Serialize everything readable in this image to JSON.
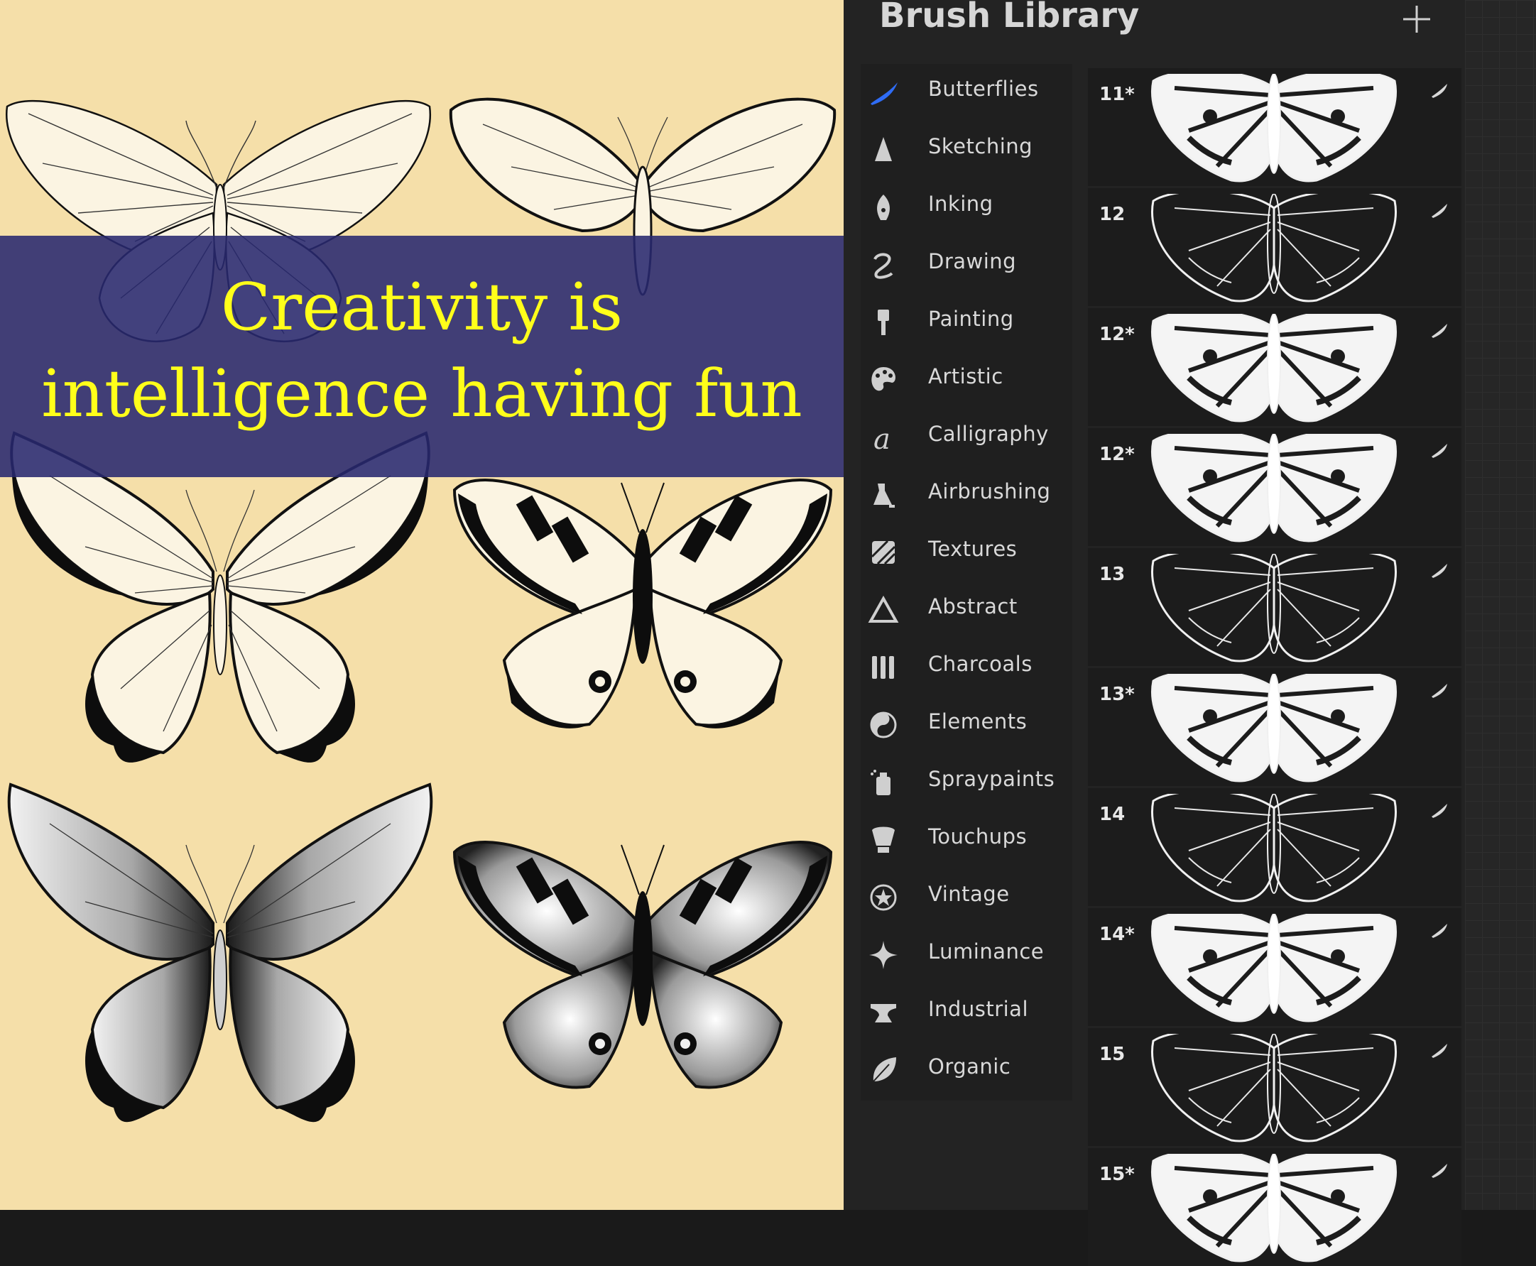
{
  "canvas": {
    "quote_line1": "Creativity is",
    "quote_line2": "intelligence having fun",
    "background_color": "#f5dfa9",
    "banner_color": "#2a2a6e",
    "quote_color": "#ffff1a"
  },
  "panel": {
    "title": "Brush Library",
    "add_icon": "plus-icon"
  },
  "brush_sets": [
    {
      "label": "Butterflies",
      "icon": "brush-stroke-icon",
      "selected": true
    },
    {
      "label": "Sketching",
      "icon": "pencil-tip-icon"
    },
    {
      "label": "Inking",
      "icon": "pen-nib-icon"
    },
    {
      "label": "Drawing",
      "icon": "squiggle-icon"
    },
    {
      "label": "Painting",
      "icon": "paint-brush-icon"
    },
    {
      "label": "Artistic",
      "icon": "palette-icon"
    },
    {
      "label": "Calligraphy",
      "icon": "script-a-icon"
    },
    {
      "label": "Airbrushing",
      "icon": "airbrush-icon"
    },
    {
      "label": "Textures",
      "icon": "hatch-square-icon"
    },
    {
      "label": "Abstract",
      "icon": "triangle-icon"
    },
    {
      "label": "Charcoals",
      "icon": "charcoal-sticks-icon"
    },
    {
      "label": "Elements",
      "icon": "yin-yang-icon"
    },
    {
      "label": "Spraypaints",
      "icon": "spray-can-icon"
    },
    {
      "label": "Touchups",
      "icon": "bucket-icon"
    },
    {
      "label": "Vintage",
      "icon": "star-circle-icon"
    },
    {
      "label": "Luminance",
      "icon": "sparkle-icon"
    },
    {
      "label": "Industrial",
      "icon": "anvil-icon"
    },
    {
      "label": "Organic",
      "icon": "leaf-icon"
    }
  ],
  "brushes": [
    {
      "number": "11*",
      "style": "filled"
    },
    {
      "number": "12",
      "style": "line"
    },
    {
      "number": "12*",
      "style": "filled"
    },
    {
      "number": "12*",
      "style": "filled"
    },
    {
      "number": "13",
      "style": "line"
    },
    {
      "number": "13*",
      "style": "filled"
    },
    {
      "number": "14",
      "style": "line"
    },
    {
      "number": "14*",
      "style": "filled"
    },
    {
      "number": "15",
      "style": "line"
    },
    {
      "number": "15*",
      "style": "filled"
    }
  ]
}
